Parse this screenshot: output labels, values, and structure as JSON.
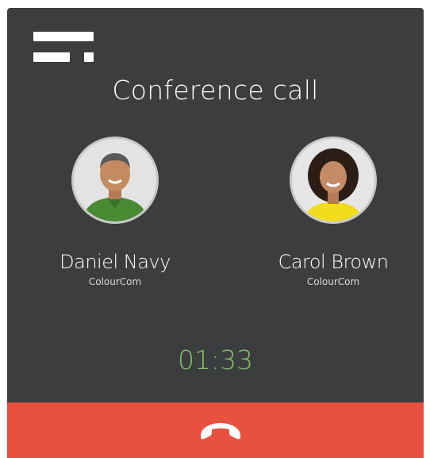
{
  "screen": {
    "title": "Conference call",
    "timer": "01:33"
  },
  "participants": [
    {
      "name": "Daniel Navy",
      "company": "ColourCom"
    },
    {
      "name": "Carol Brown",
      "company": "ColourCom"
    }
  ],
  "icons": {
    "menu": "menu-icon",
    "hangup": "phone-hangup-icon"
  },
  "colors": {
    "background": "#3b3d3f",
    "timer": "#86c16c",
    "hangup": "#e8513f"
  }
}
